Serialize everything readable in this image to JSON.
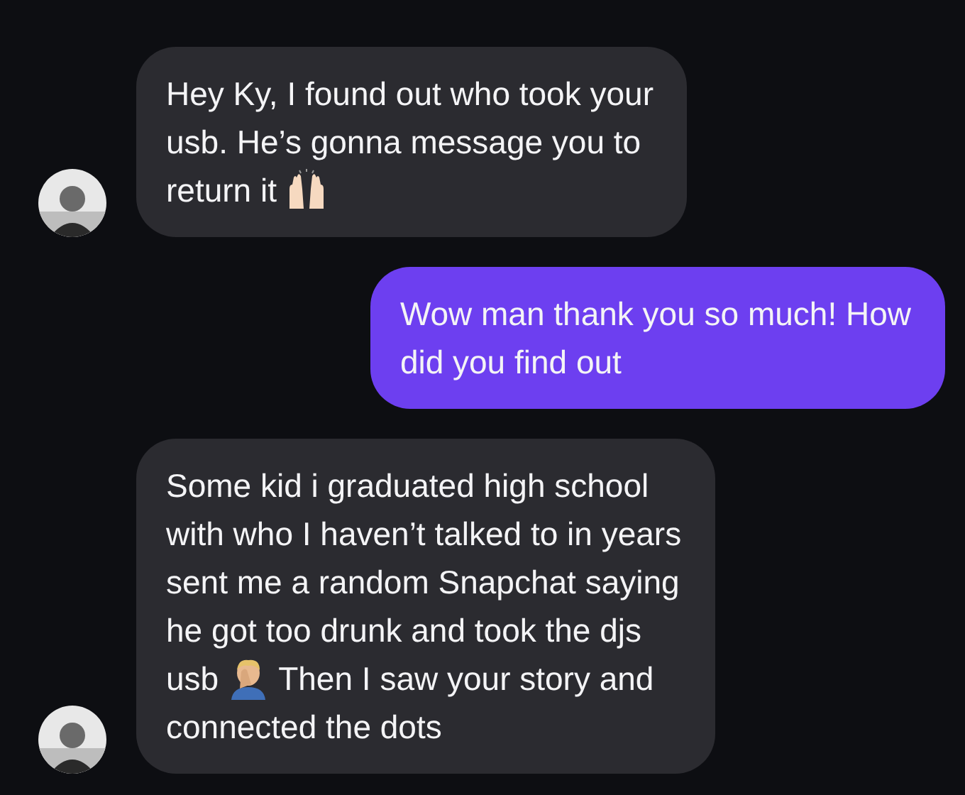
{
  "messages": [
    {
      "kind": "received",
      "lines": [
        [
          {
            "kind": "text",
            "text": "Hey Ky, I found out who took your"
          }
        ],
        [
          {
            "kind": "text",
            "text": "usb. He’s gonna message you to"
          }
        ],
        [
          {
            "kind": "text",
            "text": "return it"
          },
          {
            "kind": "hands"
          }
        ]
      ]
    },
    {
      "kind": "sent",
      "lines": [
        [
          {
            "kind": "text",
            "text": "Wow man thank you so much! How"
          }
        ],
        [
          {
            "kind": "text",
            "text": "did you find out"
          }
        ]
      ]
    },
    {
      "kind": "received",
      "lines": [
        [
          {
            "kind": "text",
            "text": "Some kid i graduated high school"
          }
        ],
        [
          {
            "kind": "text",
            "text": "with who I haven’t talked to in years"
          }
        ],
        [
          {
            "kind": "text",
            "text": "sent me a random Snapchat saying"
          }
        ],
        [
          {
            "kind": "text",
            "text": "he got too drunk and took the djs"
          }
        ],
        [
          {
            "kind": "text",
            "text": "usb"
          },
          {
            "kind": "facepalm"
          },
          {
            "kind": "text",
            "text": "Then I saw your story and"
          }
        ],
        [
          {
            "kind": "text",
            "text": "connected the dots"
          }
        ]
      ]
    }
  ]
}
